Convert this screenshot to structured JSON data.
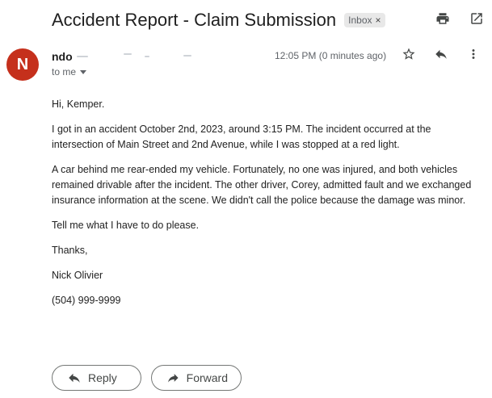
{
  "email": {
    "subject": "Accident Report - Claim Submission",
    "label": "Inbox",
    "label_close": "×",
    "sender_name": "ndo",
    "avatar_initial": "N",
    "to_label": "to me",
    "timestamp": "12:05 PM (0 minutes ago)",
    "greeting": "Hi, Kemper.",
    "paragraph1": "I got in an accident October 2nd, 2023, around 3:15 PM. The incident occurred at the intersection of Main Street and 2nd Avenue, while I was stopped at a red light.",
    "paragraph2": "A car behind me rear-ended my vehicle. Fortunately, no one was injured, and both vehicles remained drivable after the incident. The other driver, Corey, admitted fault and we exchanged insurance information at the scene. We didn't call the police because the damage was minor.",
    "paragraph3": "Tell me what I have to do please.",
    "closing": "Thanks,",
    "signature_name": "Nick Olivier",
    "signature_phone": "(504) 999-9999"
  },
  "actions": {
    "reply": "Reply",
    "forward": "Forward"
  },
  "icons": {
    "print": "print-icon",
    "open_new_window": "open-in-new-window-icon",
    "star": "star-icon",
    "reply": "reply-icon",
    "more": "more-vert-icon",
    "forward": "forward-icon"
  },
  "colors": {
    "avatar_bg": "#c5301c",
    "chip_bg": "#e8e8e8"
  }
}
